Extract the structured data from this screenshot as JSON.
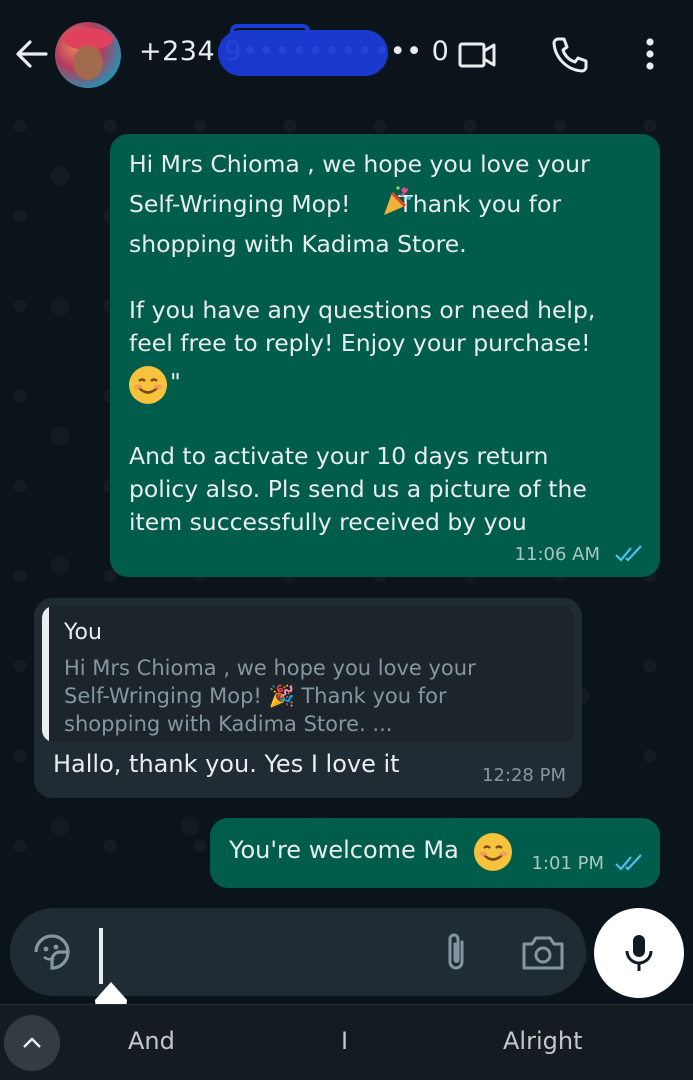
{
  "header": {
    "contact_name": "+234 9••••••••••• 0",
    "icons": [
      "back-arrow-icon",
      "video-call-icon",
      "phone-icon",
      "more-vert-icon"
    ]
  },
  "messages": [
    {
      "direction": "outgoing",
      "text_line1": "Hi Mrs Chioma , we hope you love your",
      "text_line2a": "Self-Wringing Mop!",
      "text_line2b": "Thank you for",
      "text_line3": "shopping with Kadima Store.",
      "text_para2": "If you have any questions or need help,\nfeel free to reply! Enjoy your purchase!",
      "text_quote_mark": "\"",
      "text_para3": "And to activate your 10 days return\npolicy also. Pls send us a picture of the\nitem successfully received by you",
      "time": "11:06 AM",
      "status": "read"
    },
    {
      "direction": "incoming",
      "quoted_author": "You",
      "quoted_text": "Hi Mrs Chioma , we hope you love your\nSelf-Wringing Mop! 🎉 Thank you for\nshopping with Kadima Store. ...",
      "text": "Hallo, thank you. Yes I love it",
      "time": "12:28 PM"
    },
    {
      "direction": "outgoing",
      "text": "You're welcome Ma",
      "time": "1:01 PM",
      "status": "read"
    }
  ],
  "composer": {
    "value": "",
    "icons": [
      "sticker-icon",
      "attach-icon",
      "camera-icon",
      "mic-icon"
    ]
  },
  "keyboard": {
    "suggestions": [
      "And",
      "I",
      "Alright"
    ]
  },
  "colors": {
    "outgoing_bubble": "#005c4b",
    "incoming_bubble": "#202c33",
    "read_ticks": "#53bdeb",
    "background": "#0b141a"
  }
}
